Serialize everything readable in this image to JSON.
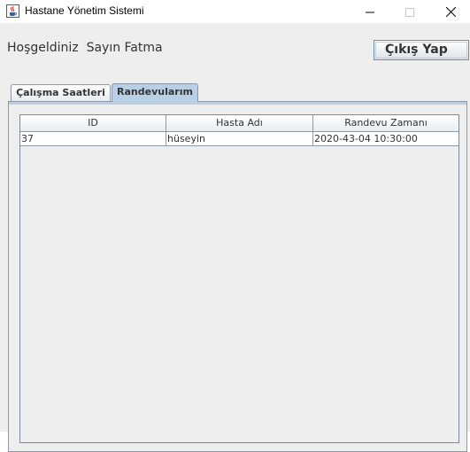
{
  "window": {
    "title": "Hastane Yönetim Sistemi",
    "icon": "java-cup-icon"
  },
  "header": {
    "welcome": "Hoşgeldiniz  Sayın Fatma",
    "logout_label": "Çıkış Yap"
  },
  "tabs": [
    {
      "label": "Çalışma Saatleri",
      "selected": false
    },
    {
      "label": "Randevularım",
      "selected": true
    }
  ],
  "table": {
    "columns": [
      "ID",
      "Hasta Adı",
      "Randevu Zamanı"
    ],
    "rows": [
      [
        "37",
        "hüseyin",
        "2020-43-04 10:30:00"
      ]
    ]
  },
  "colors": {
    "selected_tab": "#b8cfe5",
    "border": "#8e99a5",
    "panel_bg": "#eeeeee"
  }
}
